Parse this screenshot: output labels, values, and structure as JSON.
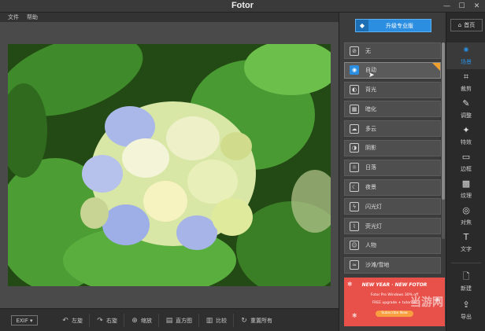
{
  "window": {
    "title": "Fotor"
  },
  "menu": [
    "文件",
    "帮助"
  ],
  "upgrade_label": "升级专业版",
  "home_label": "首页",
  "filters": [
    {
      "label": "无",
      "icon": "no-icon"
    },
    {
      "label": "自动",
      "icon": "camera-icon"
    },
    {
      "label": "背光",
      "icon": "backlight-icon"
    },
    {
      "label": "暗化",
      "icon": "dark-icon"
    },
    {
      "label": "多云",
      "icon": "cloud-icon"
    },
    {
      "label": "阴影",
      "icon": "shadow-icon"
    },
    {
      "label": "日落",
      "icon": "sunset-icon"
    },
    {
      "label": "夜景",
      "icon": "moon-icon"
    },
    {
      "label": "闪光灯",
      "icon": "flash-icon"
    },
    {
      "label": "荧光灯",
      "icon": "fluorescent-icon"
    },
    {
      "label": "人物",
      "icon": "person-icon"
    },
    {
      "label": "沙滩/雪地",
      "icon": "beach-icon"
    }
  ],
  "active_filter": "自动",
  "rail": [
    {
      "label": "场景",
      "icon": "sparkle-icon"
    },
    {
      "label": "裁剪",
      "icon": "crop-icon"
    },
    {
      "label": "调整",
      "icon": "pencil-icon"
    },
    {
      "label": "特效",
      "icon": "stars-icon"
    },
    {
      "label": "边框",
      "icon": "frame-icon"
    },
    {
      "label": "纹理",
      "icon": "texture-icon"
    },
    {
      "label": "对焦",
      "icon": "focus-icon"
    },
    {
      "label": "文字",
      "icon": "text-icon"
    },
    {
      "label": "新建",
      "icon": "new-file-icon"
    },
    {
      "label": "导出",
      "icon": "export-icon"
    }
  ],
  "bottom": {
    "exif": "EXIF ▾",
    "tools": [
      {
        "label": "左旋",
        "icon": "rotate-left-icon"
      },
      {
        "label": "右旋",
        "icon": "rotate-right-icon"
      },
      {
        "label": "缩放",
        "icon": "zoom-icon"
      },
      {
        "label": "直方图",
        "icon": "histogram-icon"
      },
      {
        "label": "比较",
        "icon": "compare-icon"
      },
      {
        "label": "重置所有",
        "icon": "reset-icon"
      }
    ]
  },
  "ad": {
    "line1": "NEW YEAR · NEW FOTOR",
    "line2": "Fotor Pro Windows 30% off",
    "line3": "FREE upgrade + tutorials",
    "button": "Subscribe Now"
  },
  "watermark": "当游网",
  "colors": {
    "accent": "#2b8ee0",
    "ad_bg": "#e8504a",
    "badge": "#f0a030"
  }
}
